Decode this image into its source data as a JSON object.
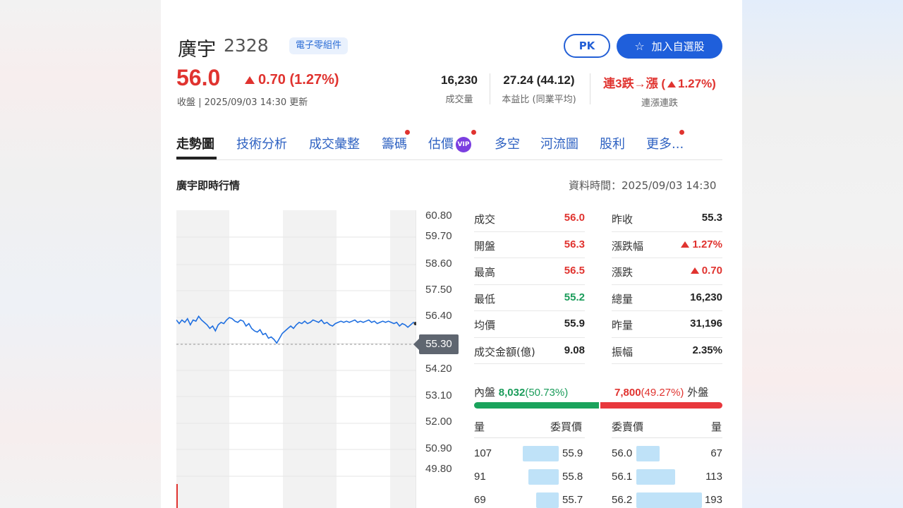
{
  "stock": {
    "name": "廣宇",
    "code": "2328",
    "category": "電子零組件",
    "price": "56.0",
    "change": "0.70 (1.27%)",
    "updated": "收盤 | 2025/09/03 14:30 更新"
  },
  "actions": {
    "pk_label": "PK",
    "fav_label": "加入自選股"
  },
  "stats": [
    {
      "value": "16,230",
      "label": "成交量"
    },
    {
      "value": "27.24 (44.12)",
      "label": "本益比 (同業平均)"
    },
    {
      "value_prefix": "連3跌→漲 (",
      "value_suffix": "1.27%)",
      "label": "連漲連跌"
    }
  ],
  "tabs": [
    "走勢圖",
    "技術分析",
    "成交彙整",
    "籌碼",
    "估價",
    "多空",
    "河流圖",
    "股利",
    "更多..."
  ],
  "vip_label": "VIP",
  "section": {
    "title": "廣宇即時行情",
    "data_time": "資料時間：2025/09/03 14:30"
  },
  "chart_data": {
    "type": "line",
    "y_ticks": [
      "60.80",
      "59.70",
      "58.60",
      "57.50",
      "56.40",
      "55.30",
      "54.20",
      "53.10",
      "52.00",
      "50.90",
      "49.80"
    ],
    "ylim": [
      49.8,
      60.8
    ],
    "reference_price": 55.3,
    "current_tag": "55.30",
    "series": [
      {
        "values": [
          56.3,
          56.15,
          56.3,
          56.2,
          56.35,
          56.1,
          56.3,
          56.25,
          56.45,
          56.3,
          56.2,
          56.1,
          55.95,
          56.05,
          55.85,
          56.1,
          56.2,
          56.15,
          56.3,
          56.4,
          56.35,
          56.25,
          56.2,
          56.3,
          56.25,
          56.05,
          56.15,
          55.95,
          55.85,
          55.8,
          55.9,
          55.7,
          55.75,
          55.55,
          55.6,
          55.5,
          55.35,
          55.55,
          55.75,
          55.85,
          55.95,
          56.05,
          55.95,
          56.1,
          56.2,
          56.15,
          56.25,
          56.15,
          56.2,
          56.3,
          56.25,
          56.2,
          56.3,
          56.15,
          56.2,
          56.1,
          56.05,
          56.15,
          56.2,
          56.25,
          56.2,
          56.25,
          56.2,
          56.25,
          56.3,
          56.2,
          56.25,
          56.2,
          56.25,
          56.3,
          56.2,
          56.25,
          56.15,
          56.2,
          56.25,
          56.2,
          56.25,
          56.2,
          56.15,
          56.2,
          56.05,
          56.15,
          56.1,
          56.0,
          56.1,
          56.2,
          56.15
        ]
      }
    ]
  },
  "quote_left": [
    {
      "key": "成交",
      "value": "56.0",
      "color": "red"
    },
    {
      "key": "開盤",
      "value": "56.3",
      "color": "red"
    },
    {
      "key": "最高",
      "value": "56.5",
      "color": "red"
    },
    {
      "key": "最低",
      "value": "55.2",
      "color": "green"
    },
    {
      "key": "均價",
      "value": "55.9",
      "color": ""
    },
    {
      "key": "成交金額(億)",
      "value": "9.08",
      "color": ""
    }
  ],
  "quote_right": [
    {
      "key": "昨收",
      "value": "55.3",
      "color": ""
    },
    {
      "key": "漲跌幅",
      "value": "1.27%",
      "color": "red",
      "arrow": true
    },
    {
      "key": "漲跌",
      "value": "0.70",
      "color": "red",
      "arrow": true
    },
    {
      "key": "總量",
      "value": "16,230",
      "color": ""
    },
    {
      "key": "昨量",
      "value": "31,196",
      "color": ""
    },
    {
      "key": "振幅",
      "value": "2.35%",
      "color": ""
    }
  ],
  "inner_outer": {
    "inner_label": "內盤",
    "inner_value": "8,032",
    "inner_pct": "(50.73%)",
    "outer_value": "7,800",
    "outer_pct": "(49.27%)",
    "outer_label": "外盤",
    "inner_ratio": 0.5073
  },
  "order_book": {
    "headers": {
      "bid_qty": "量",
      "bid_price": "委買價",
      "ask_price": "委賣價",
      "ask_qty": "量"
    },
    "rows": [
      {
        "bid_qty": "107",
        "bid_price": "55.9",
        "ask_price": "56.0",
        "ask_qty": "67"
      },
      {
        "bid_qty": "91",
        "bid_price": "55.8",
        "ask_price": "56.1",
        "ask_qty": "113"
      },
      {
        "bid_qty": "69",
        "bid_price": "55.7",
        "ask_price": "56.2",
        "ask_qty": "193"
      }
    ]
  },
  "colors": {
    "up": "#e0332f",
    "down": "#1a9c5a",
    "link": "#2f62c2",
    "line": "#1f6fe0"
  }
}
